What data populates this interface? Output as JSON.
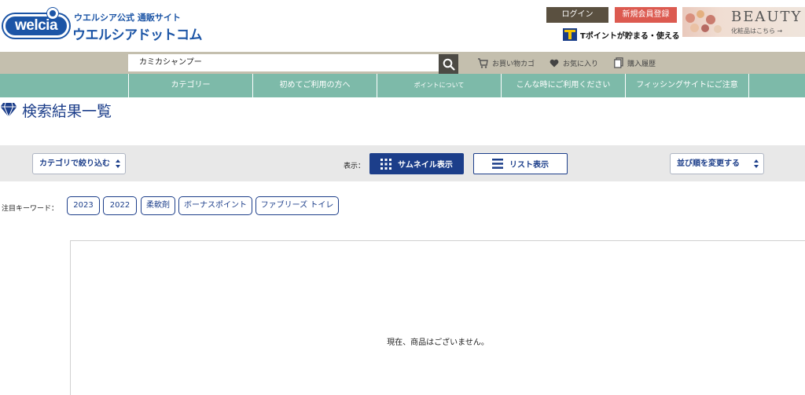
{
  "header": {
    "logo_badge": "welcia",
    "logo_sub": "ウエルシア公式 通販サイト",
    "logo_main": "ウエルシアドットコム",
    "login_label": "ログイン",
    "register_label": "新規会員登録",
    "tpoint_text": "Tポイントが貯まる・使える",
    "beauty_title": "BEAUTY",
    "beauty_sub": "化粧品はこちら →"
  },
  "search": {
    "value": "カミカシャンプー"
  },
  "utility": {
    "cart_label": "お買い物カゴ",
    "favorites_label": "お気に入り",
    "history_label": "購入履歴"
  },
  "nav": {
    "items": [
      "カテゴリー",
      "初めてご利用の方へ",
      "ポイントについて",
      "こんな時にご利用ください",
      "フィッシングサイトにご注意"
    ]
  },
  "main": {
    "page_title": "検索結果一覧",
    "category_filter": "カテゴリで絞り込む",
    "display_label": "表示：",
    "thumbnail_view": "サムネイル表示",
    "list_view": "リスト表示",
    "sort_select": "並び順を変更する",
    "keyword_label": "注目キーワード：",
    "keywords": [
      "2023",
      "2022",
      "柔軟剤",
      "ボーナスポイント",
      "ファブリーズ トイレ"
    ],
    "empty_message": "現在、商品はございません。"
  },
  "colors": {
    "brand_blue": "#1c55a6",
    "navy": "#1c3e8a",
    "nav_green": "#7dbaa9",
    "search_bar": "#c4bfae",
    "login_bg": "#5a5040",
    "register_bg": "#dc5a50"
  }
}
